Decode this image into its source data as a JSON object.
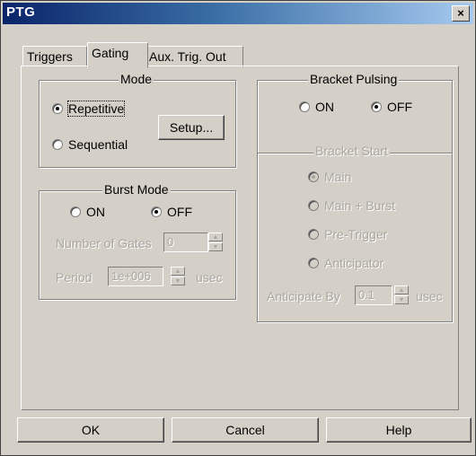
{
  "window": {
    "title": "PTG",
    "close_glyph": "×"
  },
  "tabs": [
    {
      "label": "Triggers",
      "active": false
    },
    {
      "label": "Gating",
      "active": true
    },
    {
      "label": "Aux. Trig. Out",
      "active": false
    }
  ],
  "mode": {
    "title": "Mode",
    "options": [
      {
        "label": "Repetitive",
        "selected": true
      },
      {
        "label": "Sequential",
        "selected": false
      }
    ],
    "setup_label": "Setup..."
  },
  "burst_mode": {
    "title": "Burst Mode",
    "on_label": "ON",
    "off_label": "OFF",
    "selected": "OFF",
    "gates_label": "Number of Gates",
    "gates_value": "0",
    "period_label": "Period",
    "period_value": "1e+006",
    "period_unit": "usec"
  },
  "bracket_pulsing": {
    "title": "Bracket Pulsing",
    "on_label": "ON",
    "off_label": "OFF",
    "selected": "OFF",
    "start_title": "Bracket Start",
    "start_options": [
      {
        "label": "Main",
        "selected": true
      },
      {
        "label": "Main + Burst",
        "selected": false
      },
      {
        "label": "Pre-Trigger",
        "selected": false
      },
      {
        "label": "Anticipator",
        "selected": false
      }
    ],
    "anticipate_label": "Anticipate By",
    "anticipate_value": "0.1",
    "anticipate_unit": "usec"
  },
  "buttons": {
    "ok": "OK",
    "cancel": "Cancel",
    "help": "Help"
  },
  "colors": {
    "face": "#d4d0c8",
    "title_start": "#0a246a",
    "title_end": "#a6caf0",
    "disabled": "#a9a69f"
  }
}
